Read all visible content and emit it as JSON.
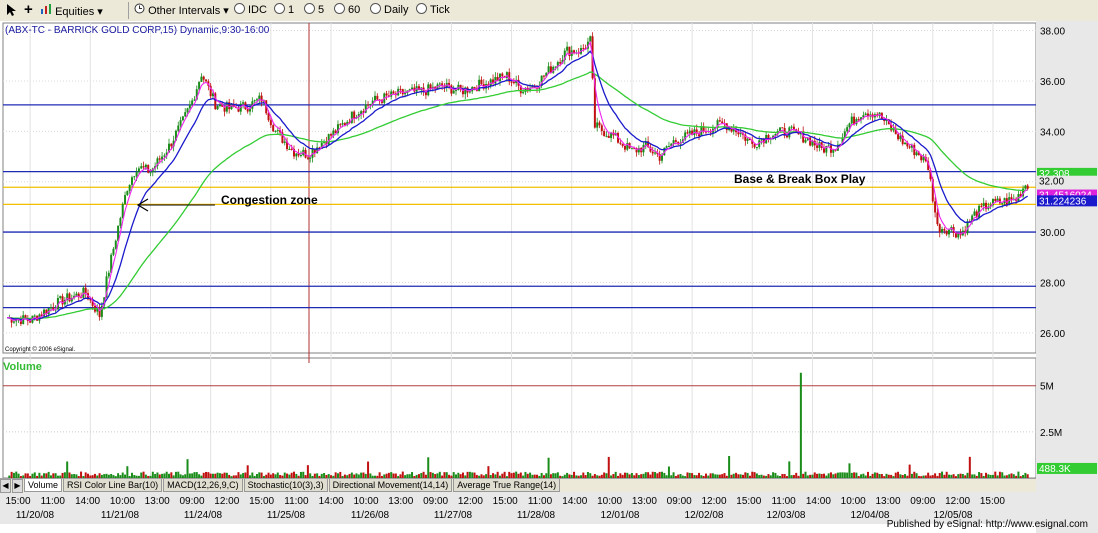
{
  "toolbar": {
    "equities_label": "Equities",
    "intervals_label": "Other Intervals",
    "r_idc": "IDC",
    "r_1": "1",
    "r_5": "5",
    "r_60": "60",
    "r_daily": "Daily",
    "r_tick": "Tick"
  },
  "chart_data": {
    "type": "candlestick",
    "title": "(ABX-TC - BARRICK GOLD CORP,15) Dynamic,9:30-16:00",
    "y_ticks": [
      "38.00",
      "36.00",
      "34.00",
      "32.00",
      "30.00",
      "28.00",
      "26.00"
    ],
    "ylim": [
      25.2,
      38.3
    ],
    "price_tags": [
      "32.308",
      "32.00",
      "31.4516024",
      "31.224236"
    ],
    "horizontal_lines": {
      "blue": [
        35.05,
        32.4,
        30.0,
        27.85,
        27.0
      ],
      "orange": [
        31.78,
        31.1
      ]
    },
    "annotations": [
      "Congestion zone",
      "Base & Break Box Play"
    ],
    "copyright": "Copyright © 2006 eSignal.",
    "volume_label": "Volume",
    "volume_ticks": [
      "5M",
      "2.5M"
    ],
    "volume_last": "488.3K",
    "x_time_labels": [
      "15:00",
      "11:00",
      "14:00",
      "10:00",
      "13:00",
      "09:00",
      "12:00",
      "15:00",
      "11:00",
      "14:00",
      "10:00",
      "13:00",
      "09:00",
      "12:00",
      "15:00",
      "11:00",
      "14:00",
      "10:00",
      "13:00",
      "09:00",
      "12:00",
      "15:00",
      "11:00",
      "14:00",
      "10:00",
      "13:00",
      "09:00",
      "12:00",
      "15:00"
    ],
    "x_date_labels": [
      "11/20/08",
      "11/21/08",
      "11/24/08",
      "11/25/08",
      "11/26/08",
      "11/27/08",
      "11/28/08",
      "12/01/08",
      "12/02/08",
      "12/03/08",
      "12/04/08",
      "12/05/08"
    ],
    "series_keypoints": [
      {
        "t": 0,
        "p": 26.6
      },
      {
        "t": 10,
        "p": 26.5
      },
      {
        "t": 24,
        "p": 27.3
      },
      {
        "t": 34,
        "p": 27.6
      },
      {
        "t": 40,
        "p": 26.7
      },
      {
        "t": 44,
        "p": 28.5
      },
      {
        "t": 48,
        "p": 30.2
      },
      {
        "t": 52,
        "p": 31.8
      },
      {
        "t": 56,
        "p": 32.6
      },
      {
        "t": 62,
        "p": 32.4
      },
      {
        "t": 70,
        "p": 33.4
      },
      {
        "t": 76,
        "p": 34.4
      },
      {
        "t": 80,
        "p": 35.2
      },
      {
        "t": 84,
        "p": 36.3
      },
      {
        "t": 90,
        "p": 35.1
      },
      {
        "t": 96,
        "p": 34.9
      },
      {
        "t": 104,
        "p": 35.0
      },
      {
        "t": 110,
        "p": 35.3
      },
      {
        "t": 116,
        "p": 34.0
      },
      {
        "t": 124,
        "p": 33.2
      },
      {
        "t": 130,
        "p": 33.1
      },
      {
        "t": 134,
        "p": 33.4
      },
      {
        "t": 142,
        "p": 34.0
      },
      {
        "t": 150,
        "p": 34.7
      },
      {
        "t": 158,
        "p": 35.2
      },
      {
        "t": 170,
        "p": 35.5
      },
      {
        "t": 180,
        "p": 35.6
      },
      {
        "t": 188,
        "p": 35.8
      },
      {
        "t": 196,
        "p": 35.6
      },
      {
        "t": 206,
        "p": 35.9
      },
      {
        "t": 216,
        "p": 36.2
      },
      {
        "t": 222,
        "p": 35.7
      },
      {
        "t": 228,
        "p": 35.8
      },
      {
        "t": 234,
        "p": 36.4
      },
      {
        "t": 242,
        "p": 37.2
      },
      {
        "t": 248,
        "p": 37.2
      },
      {
        "t": 252,
        "p": 37.6
      },
      {
        "t": 254,
        "p": 34.2
      },
      {
        "t": 262,
        "p": 33.8
      },
      {
        "t": 270,
        "p": 33.2
      },
      {
        "t": 276,
        "p": 33.4
      },
      {
        "t": 282,
        "p": 33.0
      },
      {
        "t": 288,
        "p": 33.6
      },
      {
        "t": 294,
        "p": 33.8
      },
      {
        "t": 302,
        "p": 34.1
      },
      {
        "t": 310,
        "p": 34.3
      },
      {
        "t": 316,
        "p": 34.0
      },
      {
        "t": 322,
        "p": 33.5
      },
      {
        "t": 330,
        "p": 33.9
      },
      {
        "t": 338,
        "p": 34.0
      },
      {
        "t": 346,
        "p": 33.7
      },
      {
        "t": 352,
        "p": 33.3
      },
      {
        "t": 358,
        "p": 33.4
      },
      {
        "t": 364,
        "p": 34.3
      },
      {
        "t": 370,
        "p": 34.8
      },
      {
        "t": 376,
        "p": 34.7
      },
      {
        "t": 382,
        "p": 34.1
      },
      {
        "t": 388,
        "p": 33.5
      },
      {
        "t": 394,
        "p": 33.1
      },
      {
        "t": 398,
        "p": 32.6
      },
      {
        "t": 402,
        "p": 30.2
      },
      {
        "t": 408,
        "p": 30.1
      },
      {
        "t": 412,
        "p": 29.9
      },
      {
        "t": 418,
        "p": 30.7
      },
      {
        "t": 424,
        "p": 31.1
      },
      {
        "t": 430,
        "p": 31.2
      },
      {
        "t": 436,
        "p": 31.3
      },
      {
        "t": 440,
        "p": 31.9
      }
    ],
    "volume_spike_index": 343,
    "volume_spike": 5.7
  }
}
